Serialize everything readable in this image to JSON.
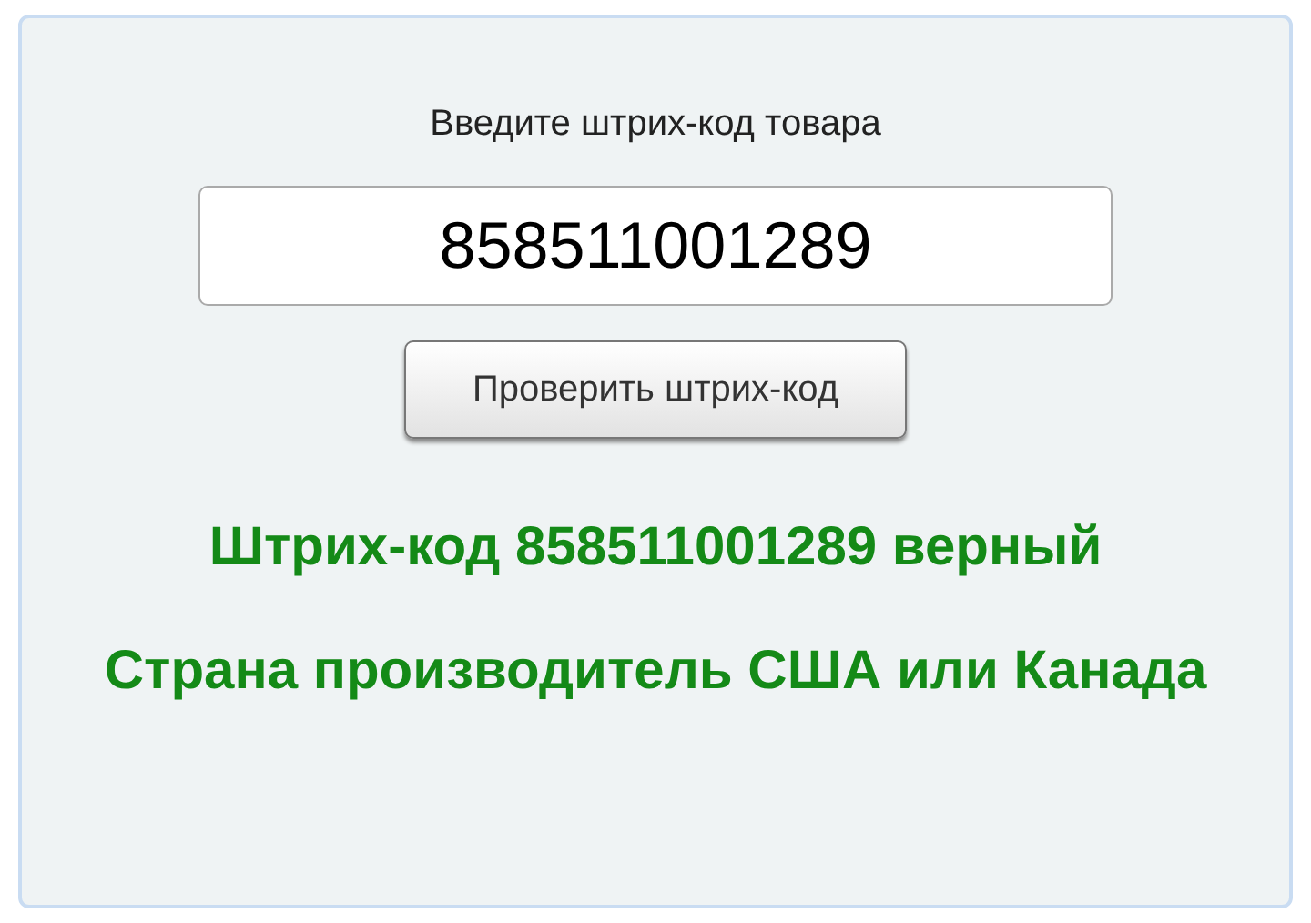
{
  "prompt": "Введите штрих-код товара",
  "barcode_field": {
    "value": "858511001289"
  },
  "check_button": "Проверить штрих-код",
  "results": [
    "Штрих-код 858511001289 верный",
    "Страна производитель США или Канада"
  ]
}
